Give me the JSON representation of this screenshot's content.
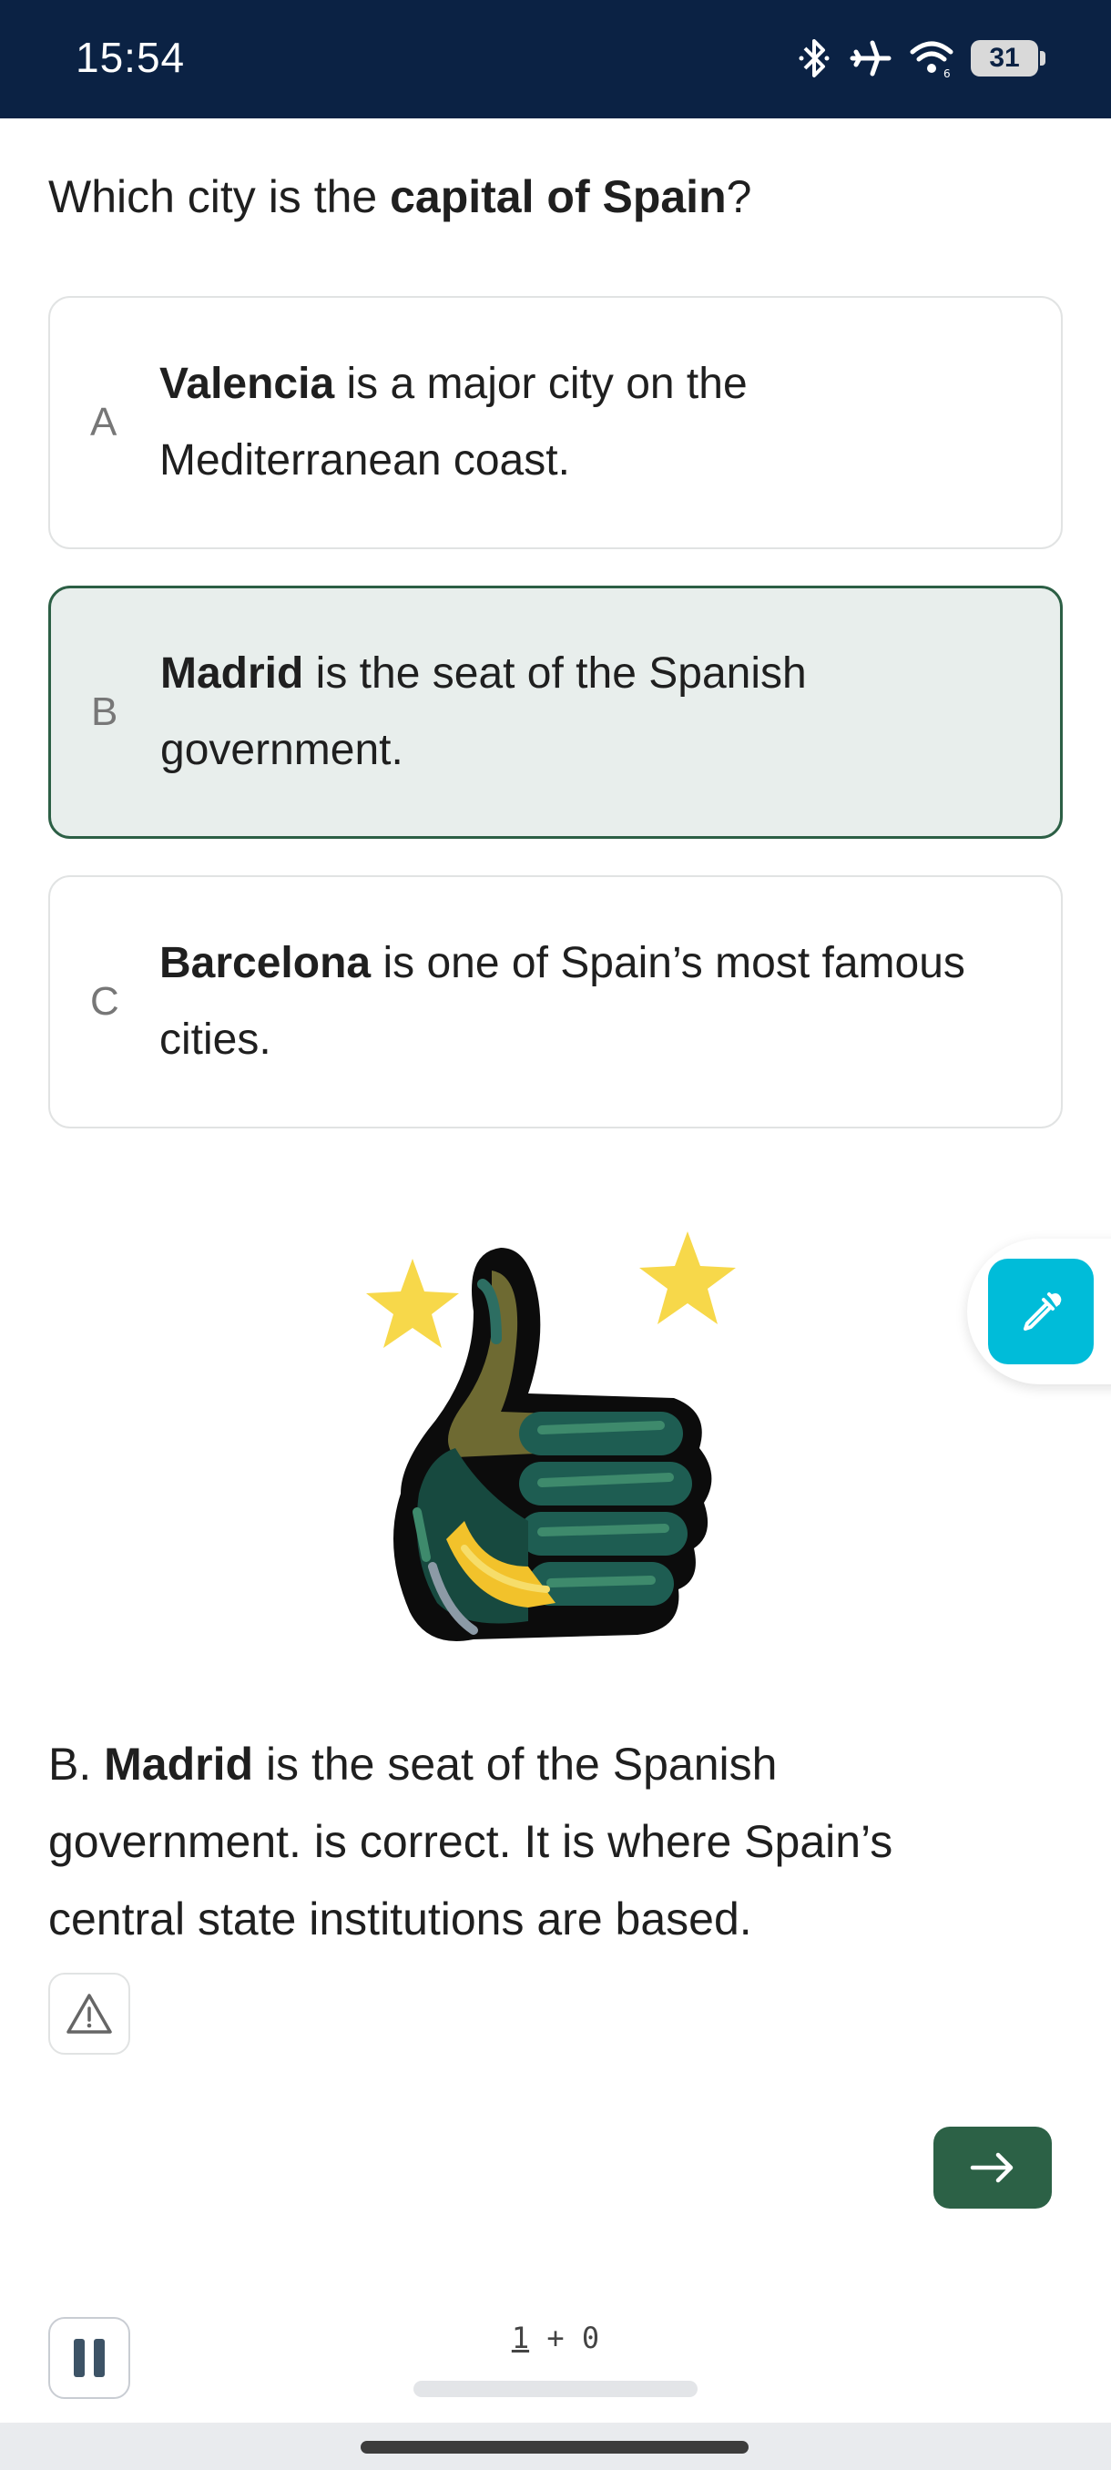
{
  "status_bar": {
    "time": "15:54",
    "battery": "31",
    "icons": [
      "bluetooth-icon",
      "airplane-icon",
      "wifi-icon",
      "battery-icon"
    ]
  },
  "question": {
    "prefix": "Which city is the ",
    "bold": "capital of Spain",
    "suffix": "?"
  },
  "options": [
    {
      "letter": "A",
      "bold": "Valencia",
      "text": " is a major city on the Mediterranean coast."
    },
    {
      "letter": "B",
      "bold": "Madrid",
      "text": " is the seat of the Spanish government."
    },
    {
      "letter": "C",
      "bold": "Barcelona",
      "text": " is one of Spain’s most famous cities."
    }
  ],
  "selected_option": "B",
  "illustration": "thumbs-up-with-stars",
  "explanation": {
    "prefix": "B. ",
    "bold": "Madrid",
    "text": " is the seat of the Spanish government. is correct. It is where Spain’s central state institutions are based."
  },
  "footer": {
    "score_current": "1",
    "score_sep": " + ",
    "score_other": "0"
  },
  "colors": {
    "status_bar_bg": "#0b2244",
    "selected_bg": "#e8eeec",
    "selected_border": "#2c5f45",
    "next_button": "#2c6146",
    "fab": "#00bcd9"
  }
}
